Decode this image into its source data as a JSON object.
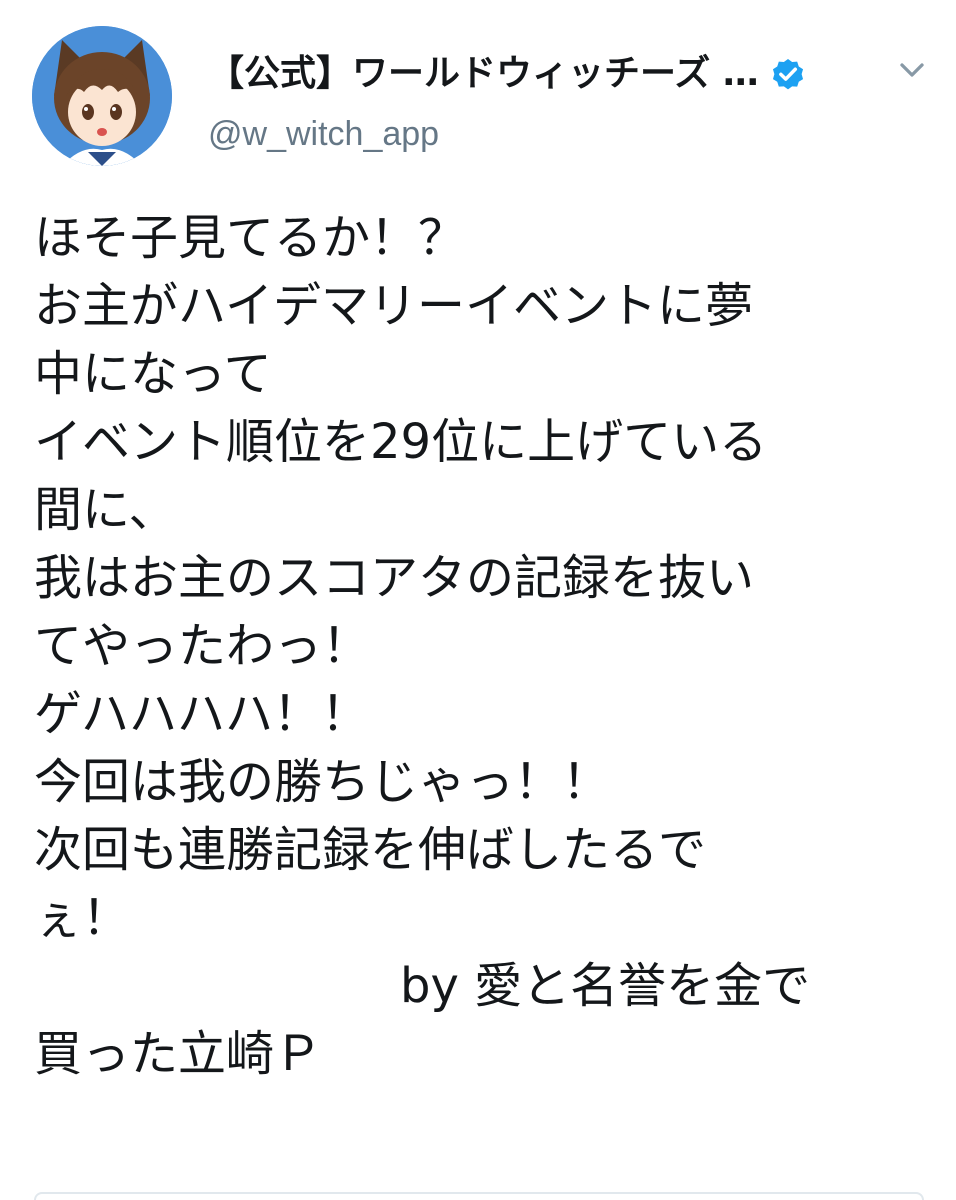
{
  "account": {
    "display_name": "【公式】ワールドウィッチーズ …",
    "handle": "@w_witch_app",
    "verified_icon": "verified-badge-icon",
    "menu_icon": "chevron-down-icon",
    "accent_color": "#1da1f2"
  },
  "tweet": {
    "lines": [
      "ほそ子見てるか！？",
      "お主がハイデマリーイベントに夢",
      "中になって",
      "イベント順位を29位に上げている",
      "間に、",
      "我はお主のスコアタの記録を抜い",
      "てやったわっ！",
      "ゲハハハハ！！",
      "今回は我の勝ちじゃっ！！",
      "次回も連勝記録を伸ばしたるで",
      "ぇ！",
      "by 愛と名誉を金で",
      "買った立崎Ｐ"
    ]
  }
}
